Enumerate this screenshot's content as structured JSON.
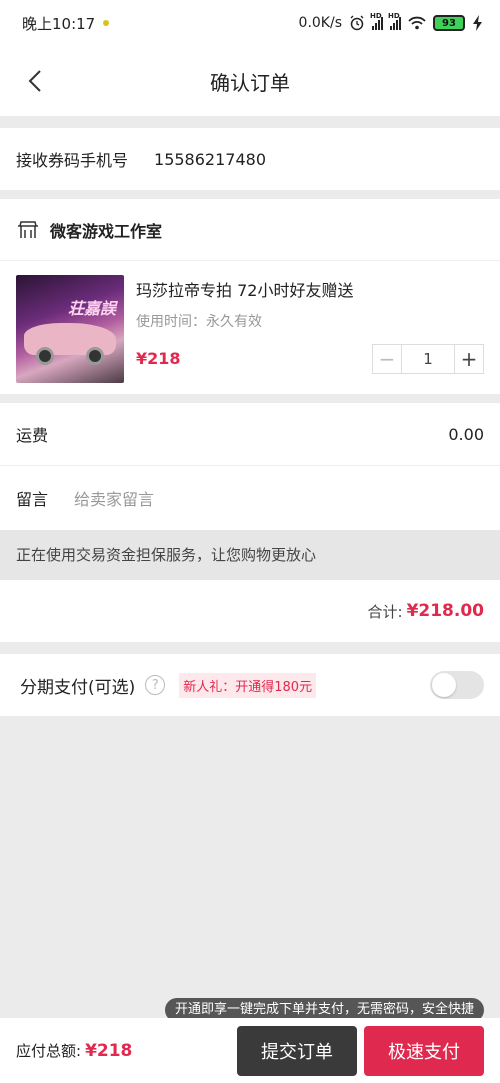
{
  "status_bar": {
    "time": "晚上10:17",
    "net_speed": "0.0K/s",
    "battery": "93"
  },
  "header": {
    "title": "确认订单"
  },
  "phone": {
    "label": "接收券码手机号",
    "value": "15586217480"
  },
  "shop": {
    "name": "微客游戏工作室"
  },
  "product": {
    "title": "玛莎拉帝专拍 72小时好友赠送",
    "usage_time": "使用时间：永久有效",
    "price": "¥218",
    "quantity": "1",
    "image_text": "荘嘉誤"
  },
  "shipping": {
    "label": "运费",
    "value": "0.00"
  },
  "message": {
    "label": "留言",
    "placeholder": "给卖家留言"
  },
  "guarantee_notice": "正在使用交易资金担保服务，让您购物更放心",
  "subtotal": {
    "label": "合计:",
    "value": "¥218.00"
  },
  "installment": {
    "label": "分期支付(可选)",
    "promo": "新人礼：开通得180元",
    "enabled": false
  },
  "tooltip": "开通即享一键完成下单并支付，无需密码，安全快捷",
  "footer": {
    "total_label": "应付总额:",
    "total_value": "¥218",
    "submit_label": "提交订单",
    "fast_pay_label": "极速支付"
  },
  "colors": {
    "accent": "#e0294e",
    "dark_button": "#3a3a3a",
    "background": "#ebebeb"
  }
}
